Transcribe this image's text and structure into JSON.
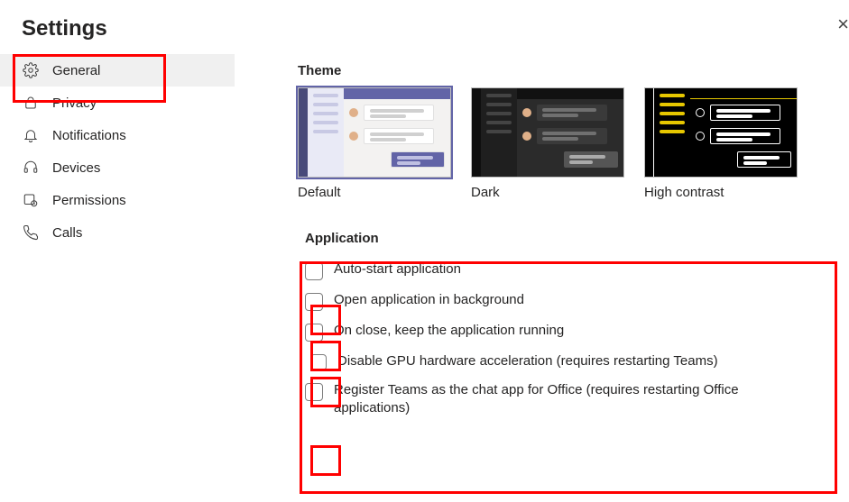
{
  "title": "Settings",
  "sidebar": {
    "items": [
      {
        "label": "General",
        "icon": "gear-icon",
        "active": true
      },
      {
        "label": "Privacy",
        "icon": "lock-icon",
        "active": false
      },
      {
        "label": "Notifications",
        "icon": "bell-icon",
        "active": false
      },
      {
        "label": "Devices",
        "icon": "headset-icon",
        "active": false
      },
      {
        "label": "Permissions",
        "icon": "permissions-icon",
        "active": false
      },
      {
        "label": "Calls",
        "icon": "phone-icon",
        "active": false
      }
    ]
  },
  "theme": {
    "heading": "Theme",
    "options": [
      {
        "label": "Default",
        "selected": true,
        "kind": "default"
      },
      {
        "label": "Dark",
        "selected": false,
        "kind": "dark"
      },
      {
        "label": "High contrast",
        "selected": false,
        "kind": "hc"
      }
    ]
  },
  "application": {
    "heading": "Application",
    "options": [
      {
        "label": "Auto-start application",
        "checked": false
      },
      {
        "label": "Open application in background",
        "checked": false
      },
      {
        "label": "On close, keep the application running",
        "checked": false
      },
      {
        "label": "Disable GPU hardware acceleration (requires restarting Teams)",
        "checked": false
      },
      {
        "label": "Register Teams as the chat app for Office (requires restarting Office applications)",
        "checked": false
      }
    ]
  },
  "highlights": {
    "color": "#ff0000",
    "boxes": [
      "nav-general",
      "application-section",
      "checkbox-0",
      "checkbox-1",
      "checkbox-2",
      "checkbox-4"
    ]
  }
}
